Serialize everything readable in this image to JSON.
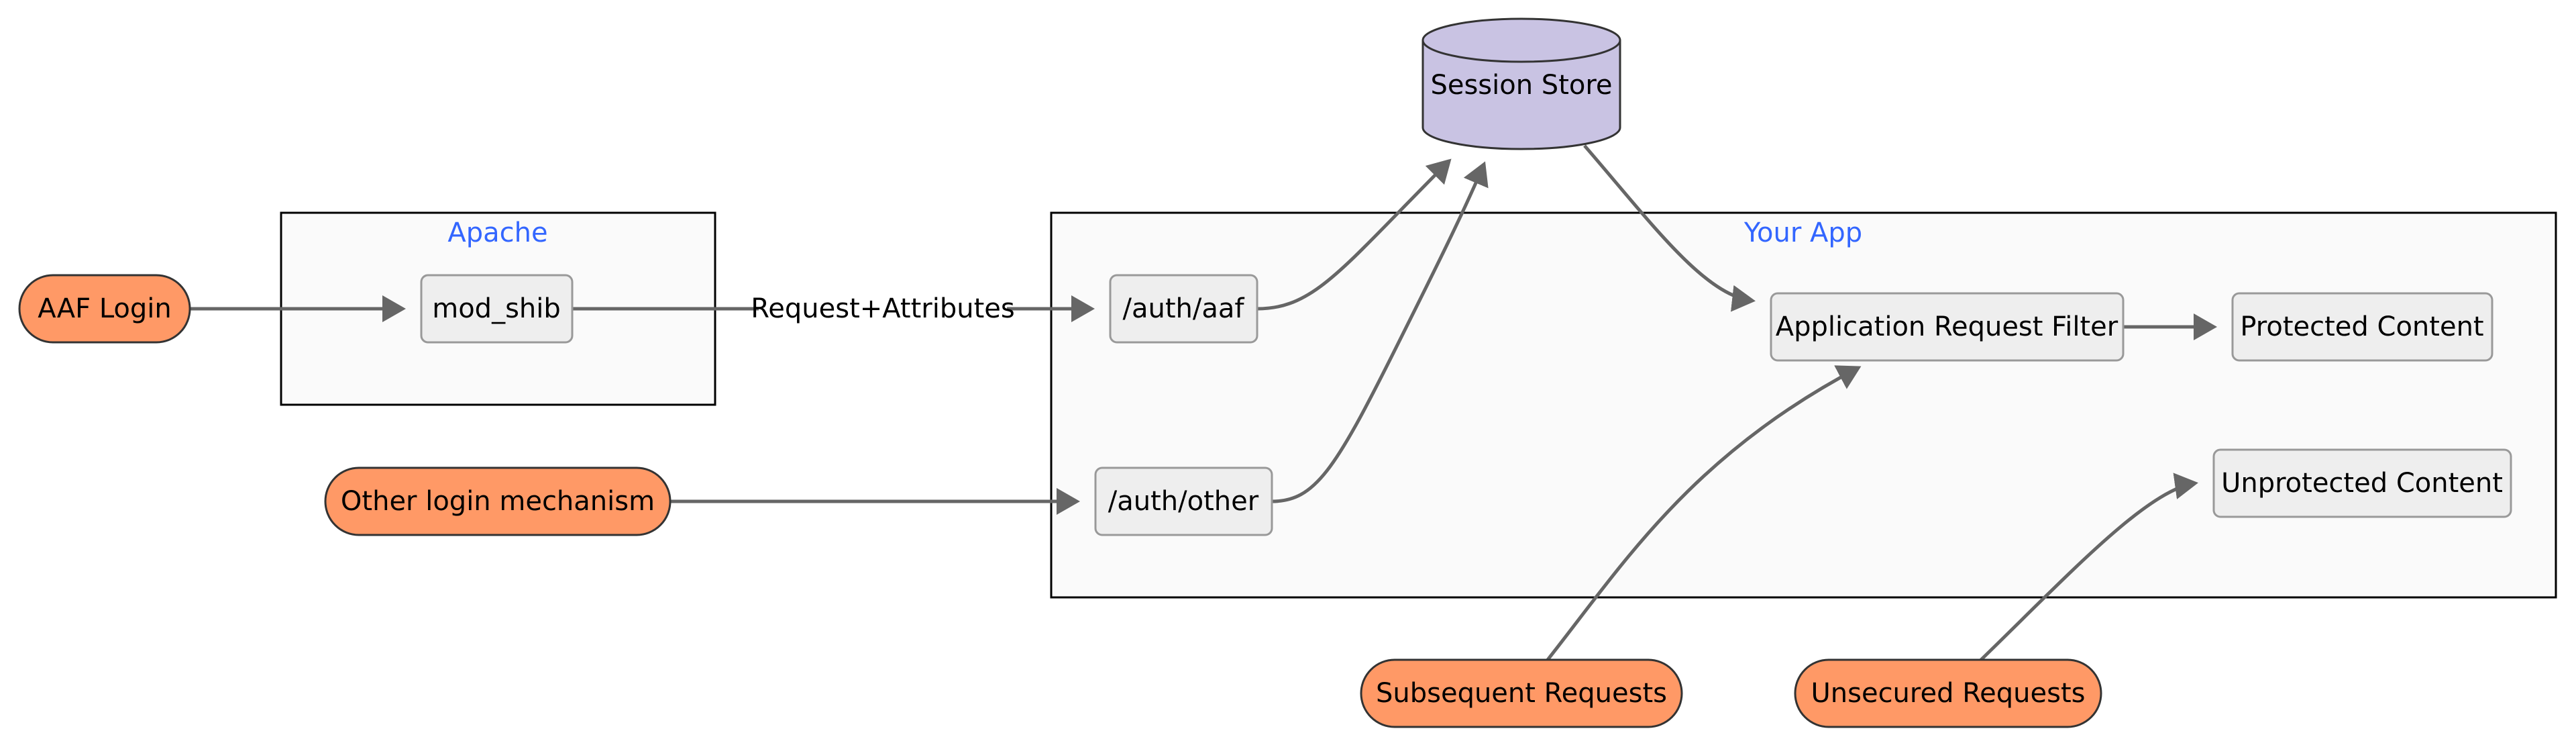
{
  "diagram": {
    "colors": {
      "start_fill": "#ff9966",
      "process_fill": "#eeeeee",
      "store_fill": "#c9c3e3",
      "cluster_label": "#3366ff",
      "edge": "#666666"
    },
    "clusters": [
      {
        "id": "apache",
        "label": "Apache"
      },
      {
        "id": "app",
        "label": "Your App"
      }
    ],
    "nodes": [
      {
        "id": "aaf_login",
        "label": "AAF Login",
        "shape": "pill",
        "cluster": null
      },
      {
        "id": "mod_shib",
        "label": "mod_shib",
        "shape": "rect",
        "cluster": "apache"
      },
      {
        "id": "other_login",
        "label": "Other login mechanism",
        "shape": "pill",
        "cluster": null
      },
      {
        "id": "auth_aaf",
        "label": "/auth/aaf",
        "shape": "rect",
        "cluster": "app"
      },
      {
        "id": "auth_other",
        "label": "/auth/other",
        "shape": "rect",
        "cluster": "app"
      },
      {
        "id": "session_store",
        "label": "Session Store",
        "shape": "cylinder",
        "cluster": null
      },
      {
        "id": "arf",
        "label": "Application Request Filter",
        "shape": "rect",
        "cluster": "app"
      },
      {
        "id": "protected",
        "label": "Protected Content",
        "shape": "rect",
        "cluster": "app"
      },
      {
        "id": "unprotected",
        "label": "Unprotected Content",
        "shape": "rect",
        "cluster": "app"
      },
      {
        "id": "subsequent",
        "label": "Subsequent Requests",
        "shape": "pill",
        "cluster": null
      },
      {
        "id": "unsecured",
        "label": "Unsecured Requests",
        "shape": "pill",
        "cluster": null
      }
    ],
    "edges": [
      {
        "from": "aaf_login",
        "to": "mod_shib",
        "label": ""
      },
      {
        "from": "mod_shib",
        "to": "auth_aaf",
        "label": "Request+Attributes"
      },
      {
        "from": "other_login",
        "to": "auth_other",
        "label": ""
      },
      {
        "from": "auth_aaf",
        "to": "session_store",
        "label": ""
      },
      {
        "from": "auth_other",
        "to": "session_store",
        "label": ""
      },
      {
        "from": "session_store",
        "to": "arf",
        "label": ""
      },
      {
        "from": "arf",
        "to": "protected",
        "label": ""
      },
      {
        "from": "subsequent",
        "to": "arf",
        "label": ""
      },
      {
        "from": "unsecured",
        "to": "unprotected",
        "label": ""
      }
    ]
  }
}
